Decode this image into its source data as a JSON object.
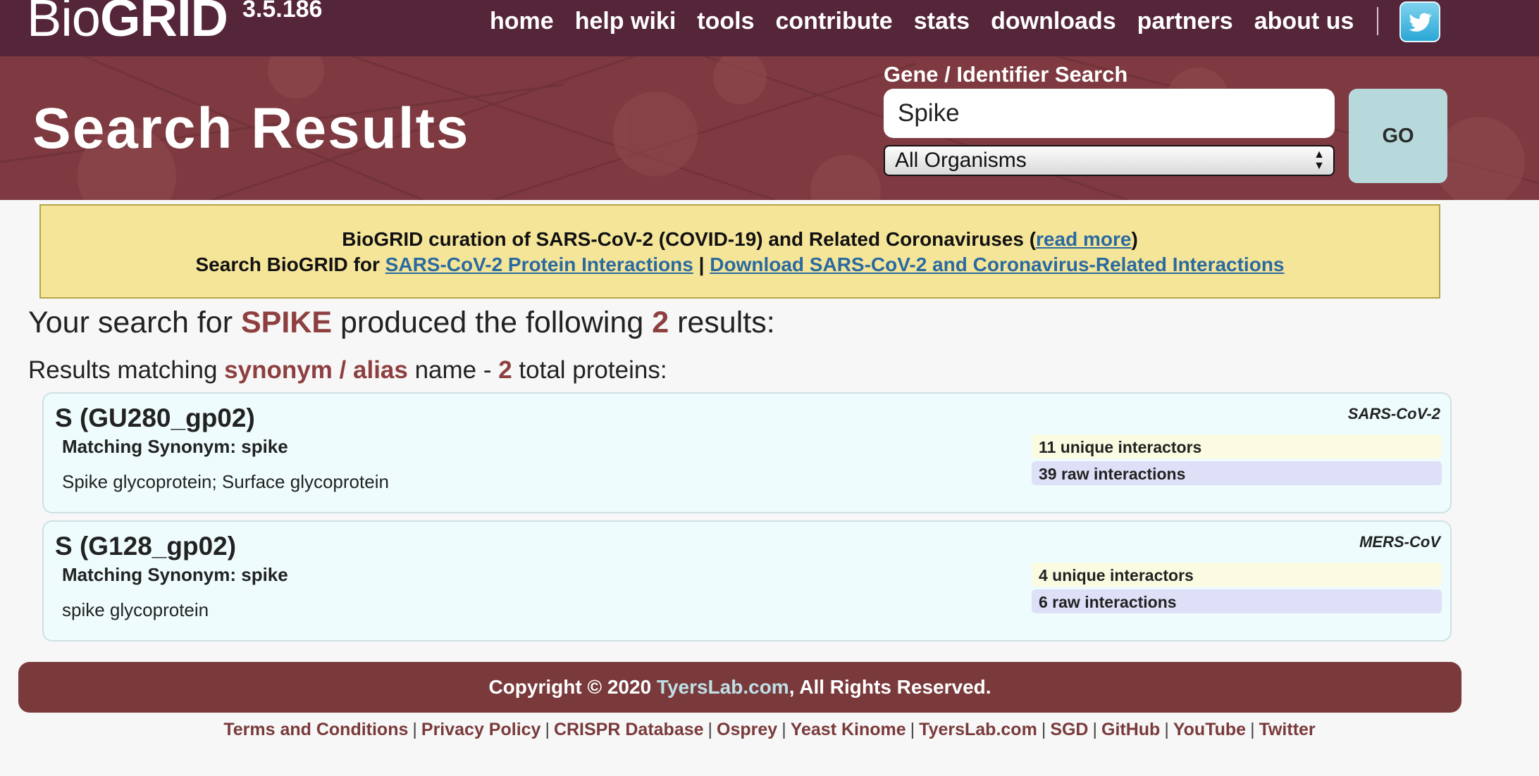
{
  "nav": {
    "logo_light": "Bio",
    "logo_bold": "GRID",
    "version": "3.5.186",
    "links": [
      "home",
      "help wiki",
      "tools",
      "contribute",
      "stats",
      "downloads",
      "partners",
      "about us"
    ],
    "twitter_icon": "twitter-bird-icon"
  },
  "header": {
    "title": "Search Results",
    "search_label": "Gene / Identifier Search",
    "search_value": "Spike",
    "organism_selected": "All Organisms",
    "go_label": "GO"
  },
  "notice": {
    "line1_prefix": "BioGRID curation of SARS-CoV-2 (COVID-19) and Related Coronaviruses (",
    "read_more": "read more",
    "line1_suffix": ")",
    "line2_prefix": "Search BioGRID for ",
    "link_protein": "SARS-CoV-2 Protein Interactions",
    "line2_sep": " | ",
    "link_download": "Download SARS-CoV-2 and Coronavirus-Related Interactions"
  },
  "summary": {
    "prefix": "Your search for ",
    "term": "SPIKE",
    "middle": " produced the following ",
    "count": "2",
    "suffix": " results:"
  },
  "subsummary": {
    "prefix": "Results matching ",
    "match_type": "synonym / alias",
    "middle": " name - ",
    "count": "2",
    "suffix": " total proteins:"
  },
  "results": [
    {
      "gene": "S (GU280_gp02)",
      "synonym": "Matching Synonym: spike",
      "description": "Spike glycoprotein; Surface glycoprotein",
      "organism": "SARS-CoV-2",
      "unique": "11 unique interactors",
      "raw": "39 raw interactions"
    },
    {
      "gene": "S (G128_gp02)",
      "synonym": "Matching Synonym: spike",
      "description": "spike glycoprotein",
      "organism": "MERS-CoV",
      "unique": "4 unique interactors",
      "raw": "6 raw interactions"
    }
  ],
  "footer": {
    "copyright_prefix": "Copyright © 2020 ",
    "copyright_link": "TyersLab.com",
    "copyright_suffix": ", All Rights Reserved.",
    "links": [
      "Terms and Conditions",
      "Privacy Policy",
      "CRISPR Database",
      "Osprey",
      "Yeast Kinome",
      "TyersLab.com",
      "SGD",
      "GitHub",
      "YouTube",
      "Twitter"
    ]
  },
  "colors": {
    "nav_bg": "#55253a",
    "banner_bg": "#7e3a40",
    "accent": "#8e3f40",
    "notice_bg": "#f5e599",
    "card_bg": "#effcfd"
  }
}
